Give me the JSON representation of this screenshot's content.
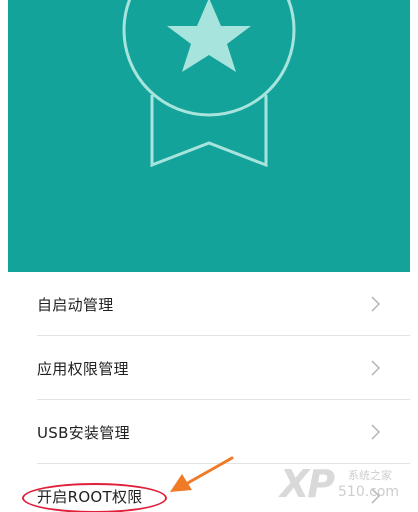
{
  "header": {
    "badge_icon": "medal-star-icon",
    "bg_color": "#14a39a"
  },
  "menu": {
    "items": [
      {
        "label": "自启动管理"
      },
      {
        "label": "应用权限管理"
      },
      {
        "label": "USB安装管理"
      },
      {
        "label": "开启ROOT权限"
      }
    ]
  },
  "annotation": {
    "highlight_color": "#e0203a",
    "arrow_color": "#f07a28"
  },
  "watermark": {
    "logo": "XP",
    "site_name": "系统之家",
    "url": "510.com"
  }
}
